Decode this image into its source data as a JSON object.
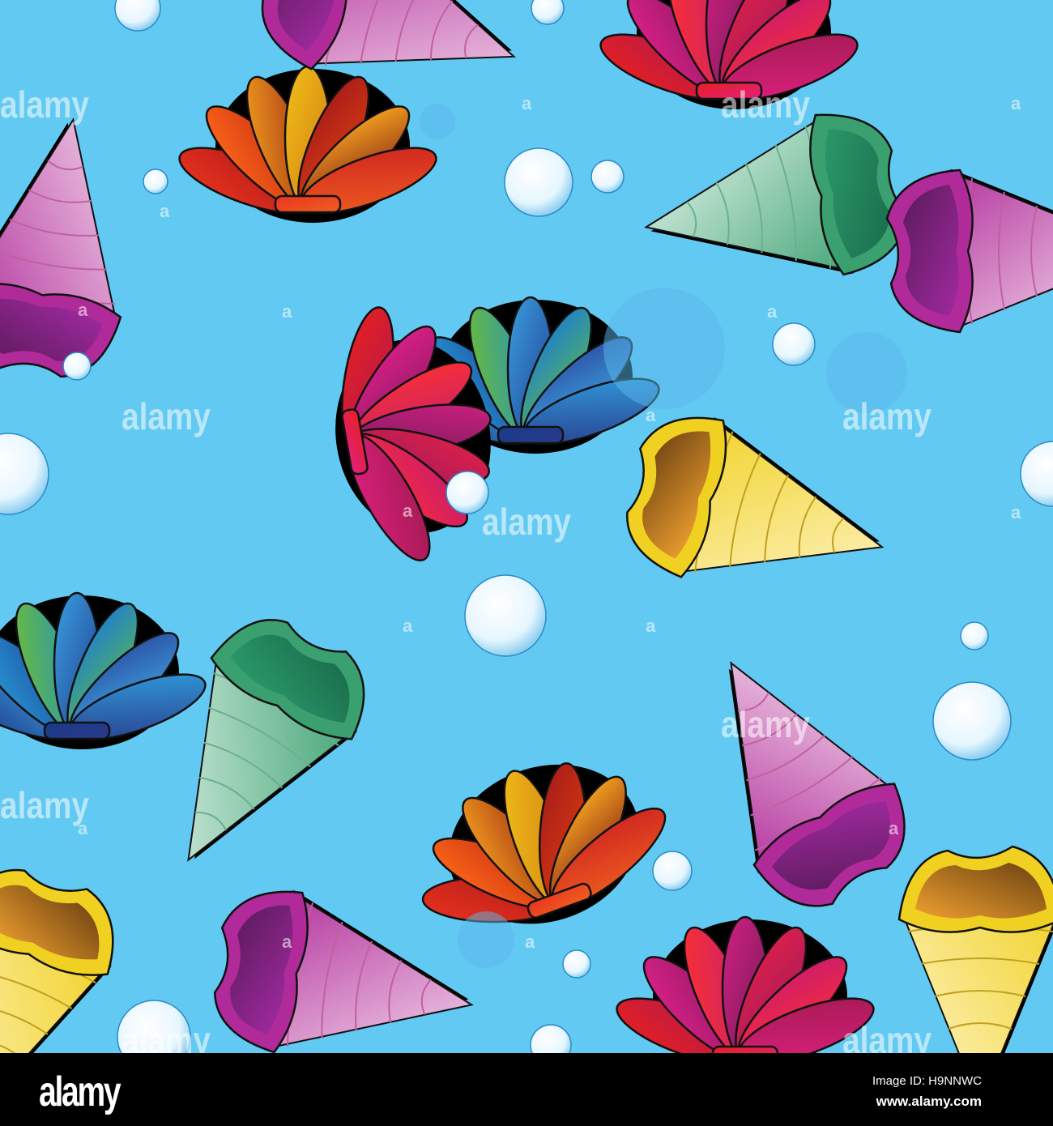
{
  "image": {
    "description_icon": "seashell-pattern",
    "background_color": "#62c9f2",
    "watermark_text": "alamy",
    "watermark_small": "a"
  },
  "footer": {
    "logo": "alamy",
    "image_id": "Image ID: H9NNWC",
    "website": "www.alamy.com"
  }
}
